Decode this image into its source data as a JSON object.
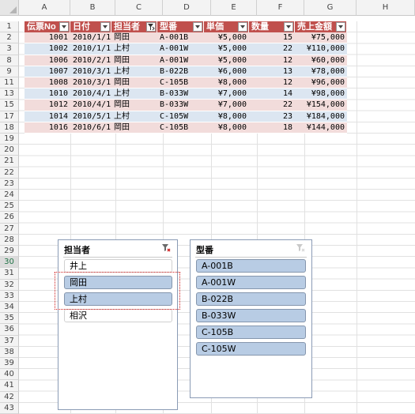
{
  "columns": [
    "A",
    "B",
    "C",
    "D",
    "E",
    "F",
    "G",
    "H"
  ],
  "rows": [
    "1",
    "2",
    "3",
    "8",
    "9",
    "11",
    "13",
    "15",
    "17",
    "18",
    "19",
    "20",
    "21",
    "22",
    "23",
    "24",
    "25",
    "26",
    "27",
    "28",
    "29",
    "30",
    "31",
    "32",
    "33",
    "34",
    "35",
    "36",
    "37",
    "38",
    "39",
    "40",
    "41",
    "42",
    "43"
  ],
  "active_row": "30",
  "table": {
    "headers": [
      "伝票No",
      "日付",
      "担当者",
      "型番",
      "単価",
      "数量",
      "売上金額"
    ],
    "filtered_header_index": 2,
    "records": [
      [
        "1001",
        "2010/1/1",
        "岡田",
        "A-001B",
        "¥5,000",
        "15",
        "¥75,000"
      ],
      [
        "1002",
        "2010/1/1",
        "上村",
        "A-001W",
        "¥5,000",
        "22",
        "¥110,000"
      ],
      [
        "1006",
        "2010/2/1",
        "岡田",
        "A-001W",
        "¥5,000",
        "12",
        "¥60,000"
      ],
      [
        "1007",
        "2010/3/1",
        "上村",
        "B-022B",
        "¥6,000",
        "13",
        "¥78,000"
      ],
      [
        "1008",
        "2010/3/1",
        "岡田",
        "C-105B",
        "¥8,000",
        "12",
        "¥96,000"
      ],
      [
        "1010",
        "2010/4/1",
        "上村",
        "B-033W",
        "¥7,000",
        "14",
        "¥98,000"
      ],
      [
        "1012",
        "2010/4/1",
        "岡田",
        "B-033W",
        "¥7,000",
        "22",
        "¥154,000"
      ],
      [
        "1014",
        "2010/5/1",
        "上村",
        "C-105W",
        "¥8,000",
        "23",
        "¥184,000"
      ],
      [
        "1016",
        "2010/6/1",
        "岡田",
        "C-105B",
        "¥8,000",
        "18",
        "¥144,000"
      ]
    ]
  },
  "slicer_person": {
    "title": "担当者",
    "items": [
      {
        "label": "井上",
        "selected": false
      },
      {
        "label": "岡田",
        "selected": true
      },
      {
        "label": "上村",
        "selected": true
      },
      {
        "label": "相沢",
        "selected": false
      }
    ]
  },
  "slicer_model": {
    "title": "型番",
    "items": [
      {
        "label": "A-001B",
        "selected": true
      },
      {
        "label": "A-001W",
        "selected": true
      },
      {
        "label": "B-022B",
        "selected": true
      },
      {
        "label": "B-033W",
        "selected": true
      },
      {
        "label": "C-105B",
        "selected": true
      },
      {
        "label": "C-105W",
        "selected": true
      }
    ]
  },
  "colors": {
    "header_fill": "#c0504d",
    "band_pink": "#f2dcdb",
    "band_blue": "#dce6f1",
    "slicer_selected": "#b8cce4",
    "highlight_border": "#d02020"
  }
}
